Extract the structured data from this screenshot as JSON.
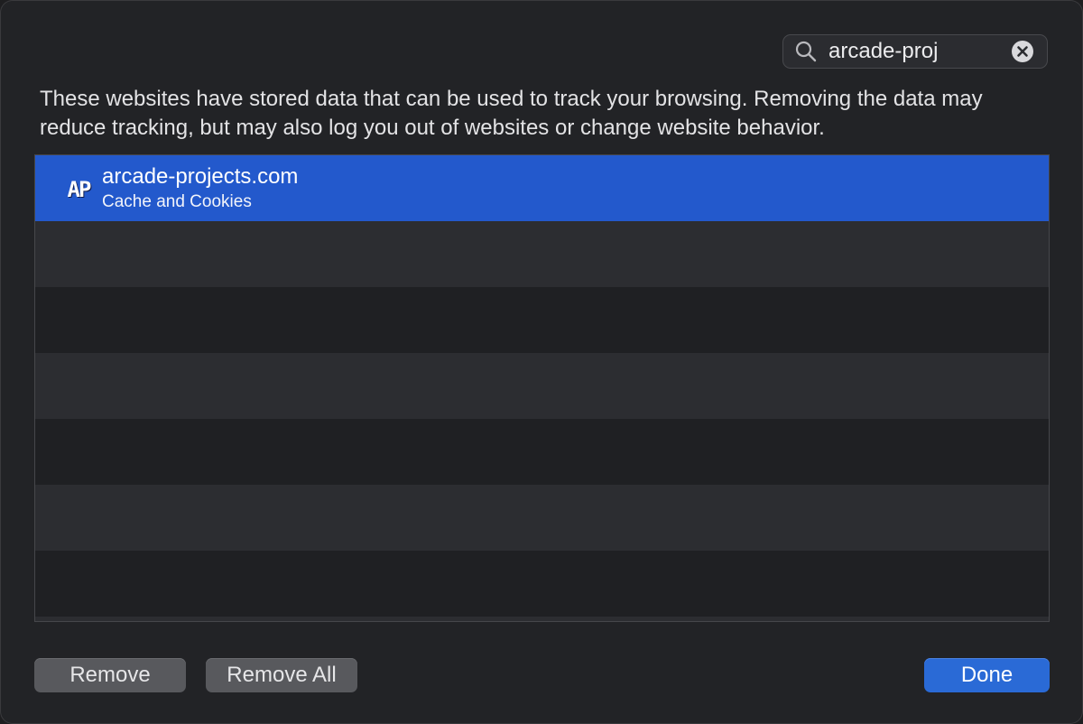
{
  "search": {
    "value": "arcade-proj"
  },
  "description": "These websites have stored data that can be used to track your browsing. Removing the data may reduce tracking, but may also log you out of websites or change website behavior.",
  "sites": [
    {
      "icon": "ap-site-icon",
      "icon_text": "AP",
      "domain": "arcade-projects.com",
      "data_types": "Cache and Cookies",
      "selected": true
    }
  ],
  "buttons": {
    "remove_label": "Remove",
    "remove_all_label": "Remove All",
    "done_label": "Done"
  },
  "colors": {
    "window_bg": "#222326",
    "selection": "#2359cc",
    "primary_button": "#2a6ad6",
    "secondary_button": "#58595d",
    "stripe": "#2c2d31"
  }
}
